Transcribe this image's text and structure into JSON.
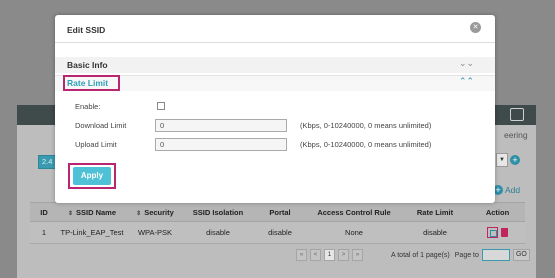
{
  "background": {
    "tab_label": "2.4",
    "header_right_text": "eering",
    "select_caret": "▼",
    "add_label": "Add",
    "table": {
      "headers": [
        "ID",
        "SSID Name",
        "Security",
        "SSID Isolation",
        "Portal",
        "Access Control Rule",
        "Rate Limit",
        "Action"
      ],
      "rows": [
        {
          "id": "1",
          "ssid_name": "TP-Link_EAP_Test",
          "security": "WPA-PSK",
          "isolation": "disable",
          "portal": "disable",
          "acl": "None",
          "rate_limit": "disable"
        }
      ]
    },
    "pager": {
      "first": "«",
      "prev": "<",
      "current": "1",
      "next": ">",
      "last": "»",
      "total_text": "A total of 1 page(s)",
      "page_to": "Page to",
      "go": "GO"
    }
  },
  "modal": {
    "title": "Edit SSID",
    "close_glyph": "✕",
    "basic_info": "Basic Info",
    "basic_chevron": "⌄⌄",
    "rate_limit": "Rate Limit",
    "rate_chevron": "⌃⌃",
    "enable_label": "Enable:",
    "download_label": "Download Limit",
    "download_value": "0",
    "download_hint": "(Kbps, 0-10240000, 0 means unlimited)",
    "upload_label": "Upload Limit",
    "upload_value": "0",
    "upload_hint": "(Kbps, 0-10240000, 0 means unlimited)",
    "apply": "Apply"
  },
  "colors": {
    "accent": "#4ec1d6",
    "highlight": "#b7266f",
    "header_dark": "#3f4a4a"
  }
}
